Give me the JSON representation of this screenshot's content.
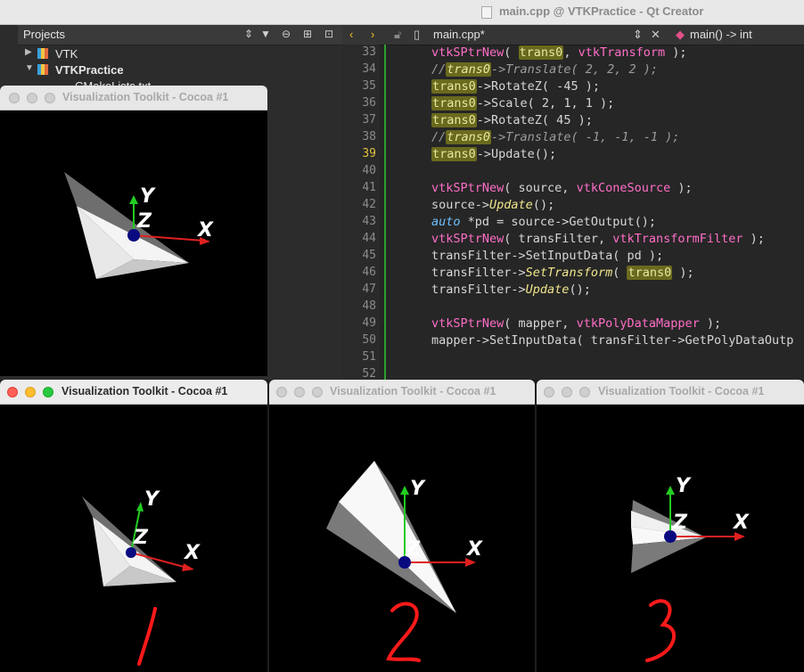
{
  "qt": {
    "title": "main.cpp @ VTKPractice - Qt Creator",
    "projects_label": "Projects",
    "tree": [
      {
        "label": "VTK"
      },
      {
        "label": "VTKPractice"
      },
      {
        "label": "CMakeLists.txt"
      }
    ],
    "editor_file": "main.cpp*",
    "function": "main() -> int"
  },
  "code_lines": [
    {
      "n": "33"
    },
    {
      "n": "34"
    },
    {
      "n": "35"
    },
    {
      "n": "36"
    },
    {
      "n": "37"
    },
    {
      "n": "38"
    },
    {
      "n": "39"
    },
    {
      "n": "40"
    },
    {
      "n": "41"
    },
    {
      "n": "42"
    },
    {
      "n": "43"
    },
    {
      "n": "44"
    },
    {
      "n": "45"
    },
    {
      "n": "46"
    },
    {
      "n": "47"
    },
    {
      "n": "48"
    },
    {
      "n": "49"
    },
    {
      "n": "50"
    },
    {
      "n": "51"
    },
    {
      "n": "52"
    }
  ],
  "vtk_windows": {
    "w0": {
      "title": "Visualization Toolkit - Cocoa #1"
    },
    "w1": {
      "title": "Visualization Toolkit - Cocoa #1"
    },
    "w2": {
      "title": "Visualization Toolkit - Cocoa #1"
    },
    "w3": {
      "title": "Visualization Toolkit - Cocoa #1"
    }
  },
  "axis_labels": {
    "x": "X",
    "y": "Y",
    "z": "Z"
  },
  "handwritten_numbers": [
    "1",
    "2",
    "3"
  ],
  "colors": {
    "x_axis": "#e02020",
    "y_axis": "#22cc22",
    "z_dot": "#0a0a80",
    "handwriting": "#ff1a1a"
  }
}
